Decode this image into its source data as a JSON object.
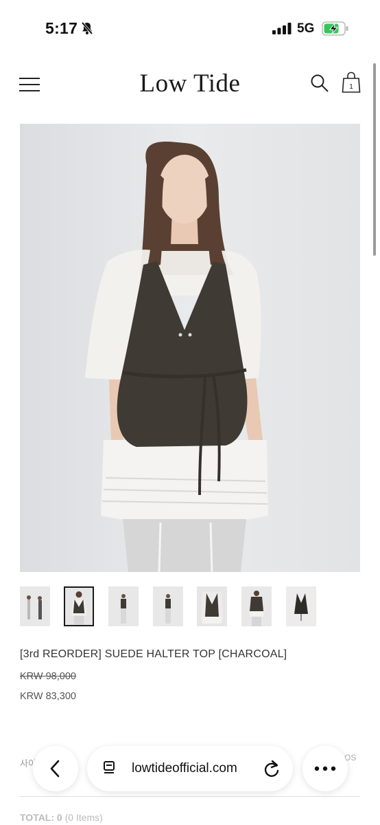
{
  "status_bar": {
    "time": "5:17",
    "network": "5G",
    "icons": [
      "bell-slash-icon",
      "signal-icon",
      "battery-charging-icon"
    ],
    "battery_color": "#34c759"
  },
  "header": {
    "brand": "Low Tide",
    "icons": [
      "menu-icon",
      "search-icon",
      "cart-icon"
    ],
    "cart_count": "1"
  },
  "gallery": {
    "main_image": "model-in-charcoal-halter-top",
    "thumbnail_count": 7,
    "active_thumbnail": 2
  },
  "product": {
    "name": "[3rd REORDER] SUEDE HALTER TOP [CHARCOAL]",
    "price_original": "KRW 98,000",
    "price_sale": "KRW 83,300"
  },
  "options": {
    "size_label": "사이",
    "size_value": "OS"
  },
  "summary": {
    "total_label": "TOTAL:",
    "total_value": "0",
    "total_items": "(0 Items)"
  },
  "browser": {
    "url": "lowtideofficial.com",
    "icons": [
      "chevron-left-icon",
      "tabs-icon",
      "reload-icon",
      "more-dots-icon"
    ]
  }
}
